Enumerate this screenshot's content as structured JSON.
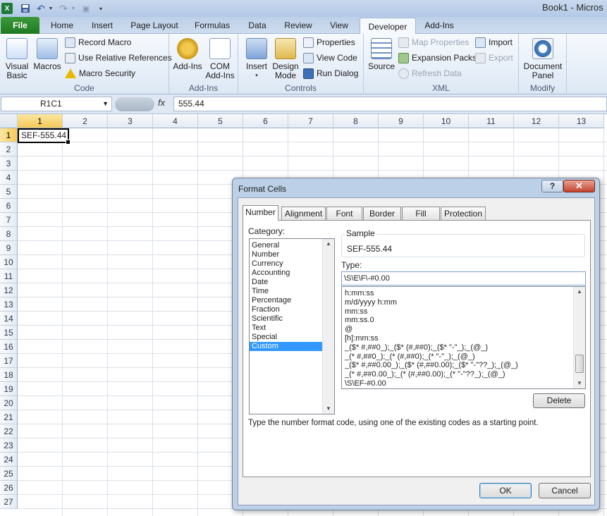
{
  "window": {
    "title": "Book1 - Micros"
  },
  "tabs": [
    "File",
    "Home",
    "Insert",
    "Page Layout",
    "Formulas",
    "Data",
    "Review",
    "View",
    "Developer",
    "Add-Ins"
  ],
  "ribbon": {
    "code": {
      "label": "Code",
      "visual_basic": "Visual\nBasic",
      "macros": "Macros",
      "record_macro": "Record Macro",
      "relative_refs": "Use Relative References",
      "macro_security": "Macro Security"
    },
    "addins": {
      "label": "Add-Ins",
      "addins": "Add-Ins",
      "com_addins": "COM\nAdd-Ins"
    },
    "controls": {
      "label": "Controls",
      "insert": "Insert",
      "design_mode": "Design\nMode",
      "properties": "Properties",
      "view_code": "View Code",
      "run_dialog": "Run Dialog"
    },
    "xml": {
      "label": "XML",
      "source": "Source",
      "map_properties": "Map Properties",
      "expansion_packs": "Expansion Packs",
      "refresh_data": "Refresh Data",
      "import": "Import",
      "export": "Export"
    },
    "modify": {
      "label": "Modify",
      "document_panel": "Document\nPanel"
    }
  },
  "formula_bar": {
    "name_box": "R1C1",
    "fx": "fx",
    "value": "555.44"
  },
  "grid": {
    "columns": [
      "1",
      "2",
      "3",
      "4",
      "5",
      "6",
      "7",
      "8",
      "9",
      "10",
      "11",
      "12",
      "13"
    ],
    "rows": [
      "1",
      "2",
      "3",
      "4",
      "5",
      "6",
      "7",
      "8",
      "9",
      "10",
      "11",
      "12",
      "13",
      "14",
      "15",
      "16",
      "17",
      "18",
      "19",
      "20",
      "21",
      "22",
      "23",
      "24",
      "25",
      "26",
      "27"
    ],
    "cell_r1c1": "SEF-555.44"
  },
  "dialog": {
    "title": "Format Cells",
    "help": "?",
    "close": "✕",
    "tabs": [
      "Number",
      "Alignment",
      "Font",
      "Border",
      "Fill",
      "Protection"
    ],
    "category_label": "Category:",
    "categories": [
      "General",
      "Number",
      "Currency",
      "Accounting",
      "Date",
      "Time",
      "Percentage",
      "Fraction",
      "Scientific",
      "Text",
      "Special",
      "Custom"
    ],
    "selected_category": "Custom",
    "sample_label": "Sample",
    "sample_value": "SEF-555.44",
    "type_label": "Type:",
    "type_value": "\\S\\E\\F\\-#0.00",
    "formats": [
      "h:mm:ss",
      "m/d/yyyy h:mm",
      "mm:ss",
      "mm:ss.0",
      "@",
      "[h]:mm:ss",
      "_($* #,##0_);_($* (#,##0);_($* \"-\"_);_(@_)",
      "_(* #,##0_);_(* (#,##0);_(* \"-\"_);_(@_)",
      "_($* #,##0.00_);_($* (#,##0.00);_($* \"-\"??_);_(@_)",
      "_(* #,##0.00_);_(* (#,##0.00);_(* \"-\"??_);_(@_)",
      "\\S\\EF-#0.00"
    ],
    "delete": "Delete",
    "hint": "Type the number format code, using one of the existing codes as a starting point.",
    "ok": "OK",
    "cancel": "Cancel"
  }
}
